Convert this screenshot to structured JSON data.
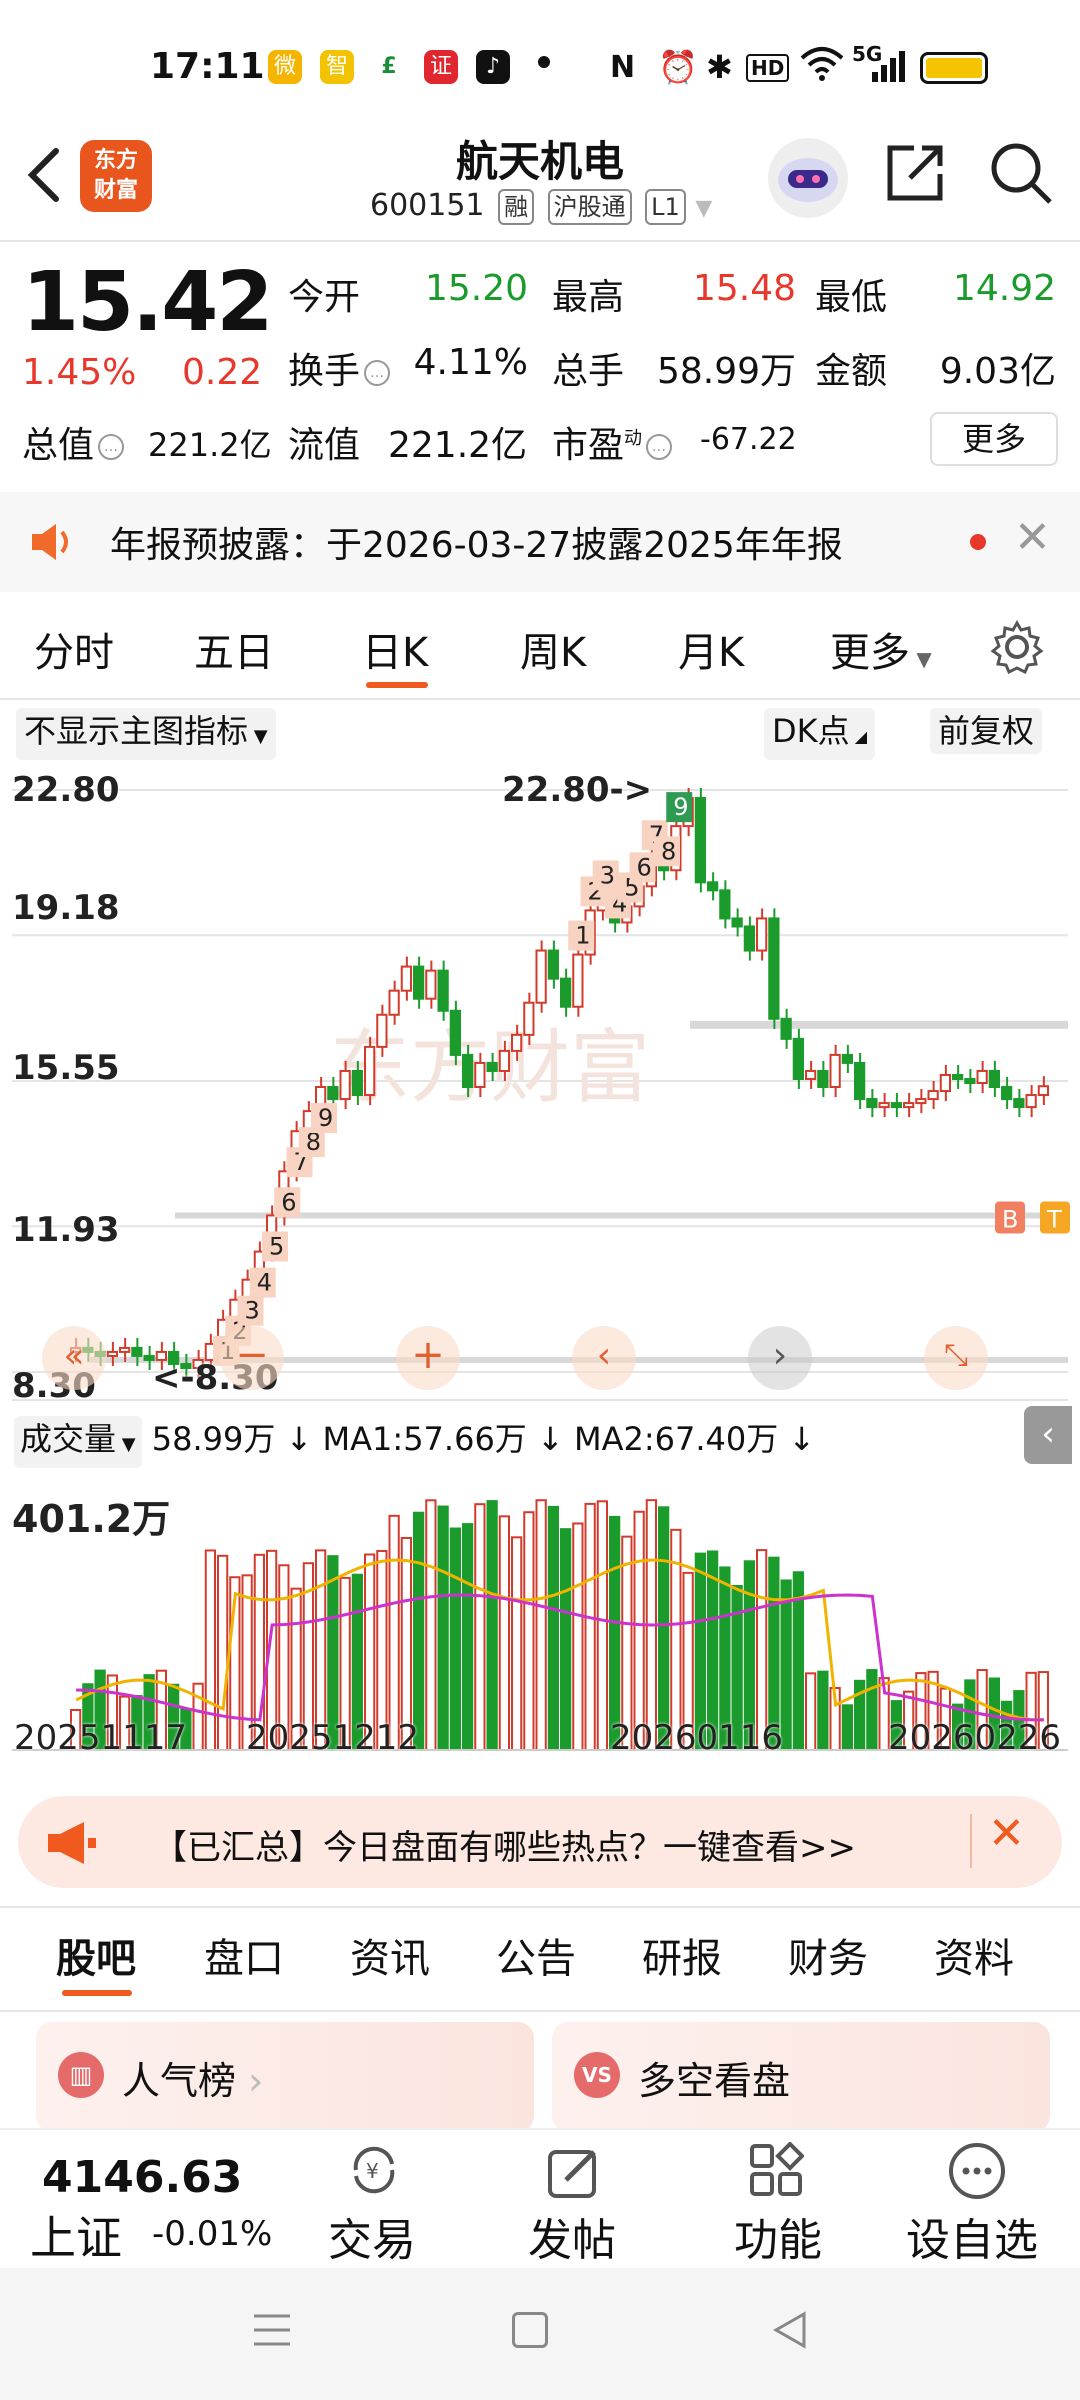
{
  "status_bar": {
    "time": "17:11",
    "network": "5G"
  },
  "header": {
    "logo_line1": "东方",
    "logo_line2": "财富",
    "title": "航天机电",
    "code": "600151",
    "tag1": "融",
    "tag2": "沪股通",
    "tag3": "L1"
  },
  "quote": {
    "price": "15.42",
    "change_pct": "1.45%",
    "change": "0.22",
    "open_label": "今开",
    "open": "15.20",
    "high_label": "最高",
    "high": "15.48",
    "low_label": "最低",
    "low": "14.92",
    "turnover_label": "换手",
    "turnover": "4.11%",
    "volume_label": "总手",
    "volume": "58.99万",
    "amount_label": "金额",
    "amount": "9.03亿",
    "mcap_label": "总值",
    "mcap": "221.2亿",
    "float_label": "流值",
    "float": "221.2亿",
    "pe_label": "市盈",
    "pe_sup": "动",
    "pe": "-67.22",
    "more": "更多",
    "up_color": "#e8382b"
  },
  "notice": {
    "text": "年报预披露：于2026-03-27披露2025年年报"
  },
  "chart_tabs": [
    "分时",
    "五日",
    "日K",
    "周K",
    "月K",
    "更多"
  ],
  "chart_tabs_active": "日K",
  "chart_toolbar": {
    "indicator": "不显示主图指标",
    "dk": "DK点",
    "adjust": "前复权"
  },
  "chart_data": {
    "type": "candlestick",
    "y_ticks": [
      "22.80",
      "19.18",
      "15.55",
      "11.93",
      "8.30"
    ],
    "y_range": [
      8.3,
      22.8
    ],
    "high_marker": "22.80->",
    "low_marker": "<-8.30",
    "x_labels": [
      "20251117",
      "20251212",
      "20260116",
      "20260226"
    ],
    "td_up_marks": [
      "1",
      "2",
      "3",
      "4",
      "5",
      "6",
      "7",
      "8",
      "9"
    ],
    "td_top_marks": [
      "1",
      "2",
      "3",
      "4",
      "5",
      "6",
      "7",
      "8",
      "9"
    ],
    "signals": [
      "B",
      "T"
    ],
    "watermark": "东方财富",
    "volume": {
      "label": "成交量",
      "value": "58.99万",
      "ma1": "MA1:57.66万",
      "ma2": "MA2:67.40万",
      "max_label": "401.2万"
    }
  },
  "banner": {
    "text": "【已汇总】今日盘面有哪些热点？一键查看>>"
  },
  "bottom_tabs": [
    "股吧",
    "盘口",
    "资讯",
    "公告",
    "研报",
    "财务",
    "资料"
  ],
  "cards": {
    "left": "人气榜",
    "right": "多空看盘"
  },
  "index": {
    "value": "4146.63",
    "name": "上证",
    "change": "-0.01%"
  },
  "bottom_actions": [
    "交易",
    "发帖",
    "功能",
    "设自选"
  ]
}
